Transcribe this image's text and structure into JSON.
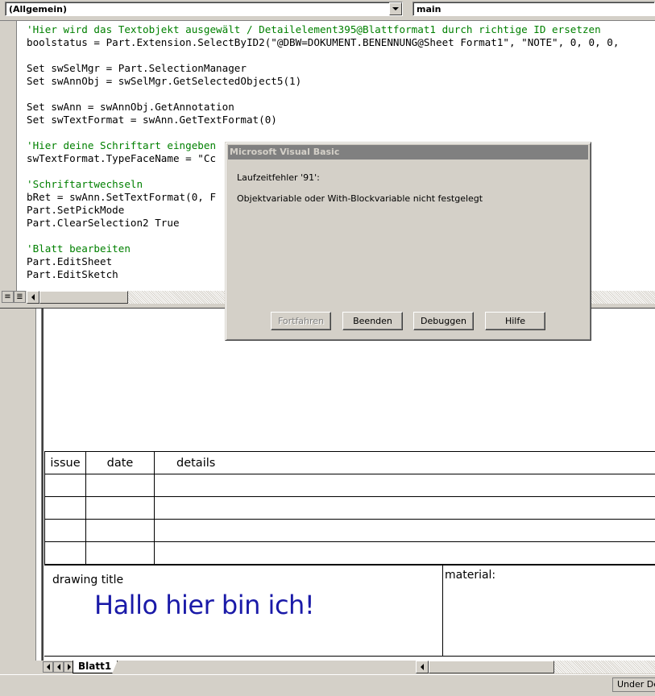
{
  "combos": {
    "object_value": "(Allgemein)",
    "procedure_value": "main"
  },
  "code": {
    "lines": [
      {
        "text": "'Hier wird das Textobjekt ausgewält / Detailelement395@Blattformat1 durch richtige ID ersetzen",
        "comment": true
      },
      {
        "text": "boolstatus = Part.Extension.SelectByID2(\"@DBW=DOKUMENT.BENENNUNG@Sheet Format1\", \"NOTE\", 0, 0, 0,",
        "comment": false
      },
      {
        "text": "",
        "comment": false
      },
      {
        "text": "Set swSelMgr = Part.SelectionManager",
        "comment": false
      },
      {
        "text": "Set swAnnObj = swSelMgr.GetSelectedObject5(1)",
        "comment": false
      },
      {
        "text": "",
        "comment": false
      },
      {
        "text": "Set swAnn = swAnnObj.GetAnnotation",
        "comment": false
      },
      {
        "text": "Set swTextFormat = swAnn.GetTextFormat(0)",
        "comment": false
      },
      {
        "text": "",
        "comment": false
      },
      {
        "text": "'Hier deine Schriftart eingeben",
        "comment": true
      },
      {
        "text": "swTextFormat.TypeFaceName = \"Cc",
        "comment": false
      },
      {
        "text": "",
        "comment": false
      },
      {
        "text": "'Schriftartwechseln",
        "comment": true
      },
      {
        "text": "bRet = swAnn.SetTextFormat(0, F",
        "comment": false
      },
      {
        "text": "Part.SetPickMode",
        "comment": false
      },
      {
        "text": "Part.ClearSelection2 True",
        "comment": false
      },
      {
        "text": "",
        "comment": false
      },
      {
        "text": "'Blatt bearbeiten",
        "comment": true
      },
      {
        "text": "Part.EditSheet",
        "comment": false
      },
      {
        "text": "Part.EditSketch",
        "comment": false
      }
    ]
  },
  "dialog": {
    "title": "Microsoft Visual Basic",
    "error_code": "Laufzeitfehler '91':",
    "message": "Objektvariable oder With-Blockvariable nicht festgelegt",
    "buttons": {
      "continue": "Fortfahren",
      "end": "Beenden",
      "debug": "Debuggen",
      "help": "Hilfe"
    }
  },
  "revision_table": {
    "headers": [
      "issue",
      "date",
      "details"
    ],
    "empty_rows": 4
  },
  "title_block": {
    "title_label": "drawing title",
    "title_value": "Hallo hier bin ich!",
    "material_label": "material:",
    "title_color": "#1a1aa8"
  },
  "sheet_tab": {
    "label": "Blatt1"
  },
  "status": {
    "field": "Under Def"
  }
}
